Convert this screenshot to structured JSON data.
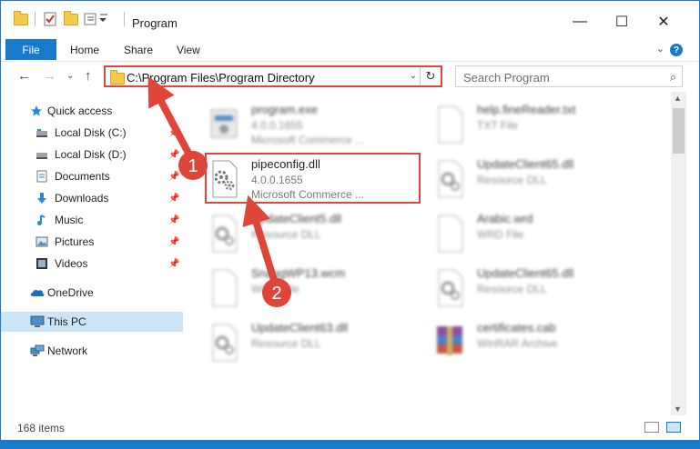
{
  "window": {
    "title": "Program",
    "controls": {
      "minimize": "—",
      "maximize": "☐",
      "close": "✕"
    }
  },
  "ribbon": {
    "file_tab": "File",
    "tabs": [
      "Home",
      "Share",
      "View"
    ],
    "help": "?"
  },
  "navigation": {
    "address": "C:\\Program Files\\Program Directory",
    "search_placeholder": "Search Program"
  },
  "sidebar": {
    "items": [
      {
        "label": "Quick access",
        "icon": "star-icon"
      },
      {
        "label": "Local Disk (C:)",
        "icon": "drive-icon",
        "pinned": true
      },
      {
        "label": "Local Disk (D:)",
        "icon": "drive-icon",
        "pinned": true
      },
      {
        "label": "Documents",
        "icon": "documents-icon",
        "pinned": true
      },
      {
        "label": "Downloads",
        "icon": "downloads-icon",
        "pinned": true
      },
      {
        "label": "Music",
        "icon": "music-icon",
        "pinned": true
      },
      {
        "label": "Pictures",
        "icon": "pictures-icon",
        "pinned": true
      },
      {
        "label": "Videos",
        "icon": "videos-icon",
        "pinned": true
      },
      {
        "label": "OneDrive",
        "icon": "onedrive-icon"
      },
      {
        "label": "This PC",
        "icon": "pc-icon",
        "selected": true
      },
      {
        "label": "Network",
        "icon": "network-icon"
      }
    ]
  },
  "files": [
    {
      "name": "program.exe",
      "line1": "4.0.0.1655",
      "line2": "Microsoft Commerce ...",
      "icon": "exe-icon"
    },
    {
      "name": "help.fineReader.txt",
      "line1": "TXT File",
      "line2": "",
      "icon": "text-file-icon"
    },
    {
      "name": "pipeconfig.dll",
      "line1": "4.0.0.1655",
      "line2": "Microsoft Commerce ...",
      "icon": "dll-icon",
      "highlighted": true
    },
    {
      "name": "UpdateClient65.dll",
      "line1": "Resource DLL",
      "line2": "",
      "icon": "dll-icon"
    },
    {
      "name": "UpdateClient5.dll",
      "line1": "Resource DLL",
      "line2": "",
      "icon": "dll-icon"
    },
    {
      "name": "Arabic.wrd",
      "line1": "WRD File",
      "line2": "",
      "icon": "generic-file-icon"
    },
    {
      "name": "SnaggWP13.wcm",
      "line1": "WCM File",
      "line2": "",
      "icon": "generic-file-icon"
    },
    {
      "name": "UpdateClient65.dll",
      "line1": "Resource DLL",
      "line2": "",
      "icon": "dll-icon"
    },
    {
      "name": "UpdateClient63.dll",
      "line1": "Resource DLL",
      "line2": "",
      "icon": "dll-icon"
    },
    {
      "name": "certificates.cab",
      "line1": "WinRAR Archive",
      "line2": "",
      "icon": "winrar-icon"
    }
  ],
  "status": {
    "item_count": "168 items"
  },
  "annotations": {
    "step1": "1",
    "step2": "2",
    "color": "#e0453a"
  }
}
